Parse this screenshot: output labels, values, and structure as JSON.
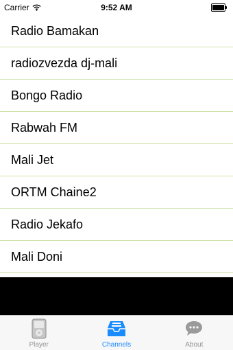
{
  "status_bar": {
    "carrier": "Carrier",
    "time": "9:52 AM"
  },
  "channels": [
    "Radio Bamakan",
    "radiozvezda dj-mali",
    "Bongo Radio",
    "Rabwah FM",
    "Mali Jet",
    "ORTM Chaine2",
    "Radio Jekafo",
    "Mali Doni"
  ],
  "tab_bar": {
    "tabs": [
      {
        "label": "Player",
        "icon": "ipod-icon",
        "active": false
      },
      {
        "label": "Channels",
        "icon": "inbox-icon",
        "active": true
      },
      {
        "label": "About",
        "icon": "speech-bubble-icon",
        "active": false
      }
    ]
  },
  "colors": {
    "accent": "#1a8cff",
    "row_separator": "#cfe0a8",
    "tab_inactive": "#929292"
  }
}
